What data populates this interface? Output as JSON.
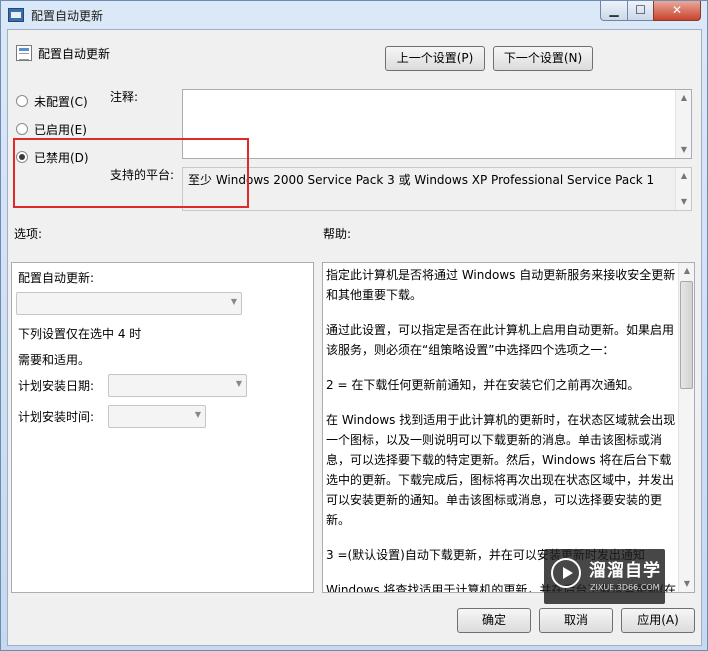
{
  "window": {
    "title": "配置自动更新",
    "minimize": "▁",
    "maximize": "☐",
    "close": "✕"
  },
  "header": {
    "policy_name": "配置自动更新",
    "prev_button": "上一个设置(P)",
    "next_button": "下一个设置(N)"
  },
  "state": {
    "options": [
      {
        "label": "未配置(C)",
        "selected": false
      },
      {
        "label": "已启用(E)",
        "selected": false
      },
      {
        "label": "已禁用(D)",
        "selected": true
      }
    ]
  },
  "comment": {
    "label": "注释:",
    "value": ""
  },
  "platform": {
    "label": "支持的平台:",
    "value": "至少 Windows 2000 Service Pack 3 或 Windows XP Professional Service Pack 1"
  },
  "options_panel": {
    "label": "选项:",
    "configure_label": "配置自动更新:",
    "configure_value": "",
    "note_line1": "下列设置仅在选中 4 时",
    "note_line2": "需要和适用。",
    "schedule_day_label": "计划安装日期:",
    "schedule_day_value": "",
    "schedule_time_label": "计划安装时间:",
    "schedule_time_value": ""
  },
  "help_panel": {
    "label": "帮助:",
    "paragraphs": [
      "指定此计算机是否将通过 Windows 自动更新服务来接收安全更新和其他重要下载。",
      "通过此设置，可以指定是否在此计算机上启用自动更新。如果启用该服务，则必须在“组策略设置”中选择四个选项之一：",
      "2 = 在下载任何更新前通知，并在安装它们之前再次通知。",
      "在 Windows 找到适用于此计算机的更新时，在状态区域就会出现一个图标，以及一则说明可以下载更新的消息。单击该图标或消息，可以选择要下载的特定更新。然后，Windows 将在后台下载选中的更新。下载完成后，图标将再次出现在状态区域中，并发出可以安装更新的通知。单击该图标或消息，可以选择要安装的更新。",
      "3 =(默认设置)自动下载更新，并在可以安装更新时发出通知",
      "Windows 将查找适用于计算机的更新，并在后台下载这些更新(在此进程中，用户不会收到通知或被打断工作)。下载完成后，图标将出现在状态区域中，并发出可以安装更新的通知。单击该图标或消息，可以选择要安装的更新。"
    ]
  },
  "footer": {
    "ok_button": "确定",
    "cancel_button": "取消",
    "apply_button": "应用(A)"
  },
  "watermark": {
    "main": "溜溜自学",
    "sub": "ZIXUE.3D66.COM"
  },
  "colors": {
    "highlight": "#e02a2a",
    "client_bg": "#f0f0f0",
    "title_bg": "#c6d9ef"
  }
}
